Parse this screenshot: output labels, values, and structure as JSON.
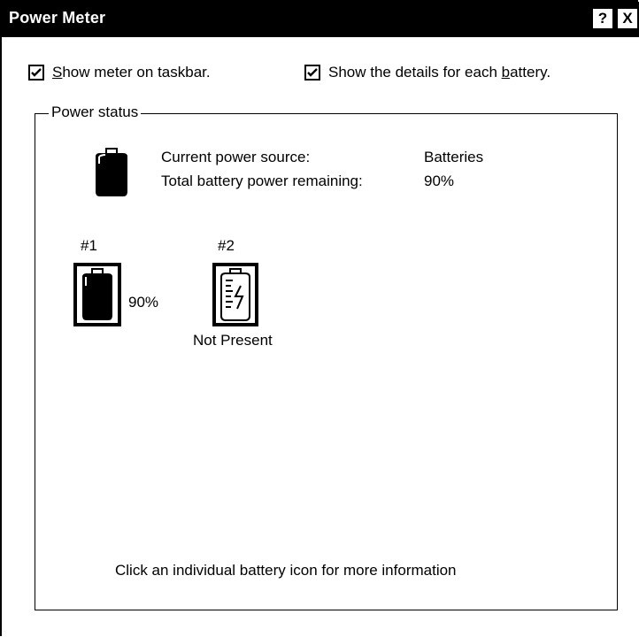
{
  "window": {
    "title": "Power Meter",
    "help_label": "?",
    "close_label": "X"
  },
  "options": {
    "show_meter": {
      "label_prefix": "",
      "label_accel": "S",
      "label_rest": "how meter on taskbar.",
      "checked": true
    },
    "show_details": {
      "label_prefix": "Show the details for each ",
      "label_accel": "b",
      "label_rest": "attery.",
      "checked": true
    }
  },
  "power_status": {
    "group_label": "Power status",
    "source_label": "Current power source:",
    "source_value": "Batteries",
    "remaining_label": "Total battery power remaining:",
    "remaining_value": "90%",
    "main_icon": "battery-icon"
  },
  "batteries": [
    {
      "id": "#1",
      "status": "90%",
      "icon": "battery-full-icon",
      "charge": 0.9
    },
    {
      "id": "#2",
      "status": "Not Present",
      "icon": "battery-not-present-icon"
    }
  ],
  "hint": "Click an individual battery icon for more information"
}
